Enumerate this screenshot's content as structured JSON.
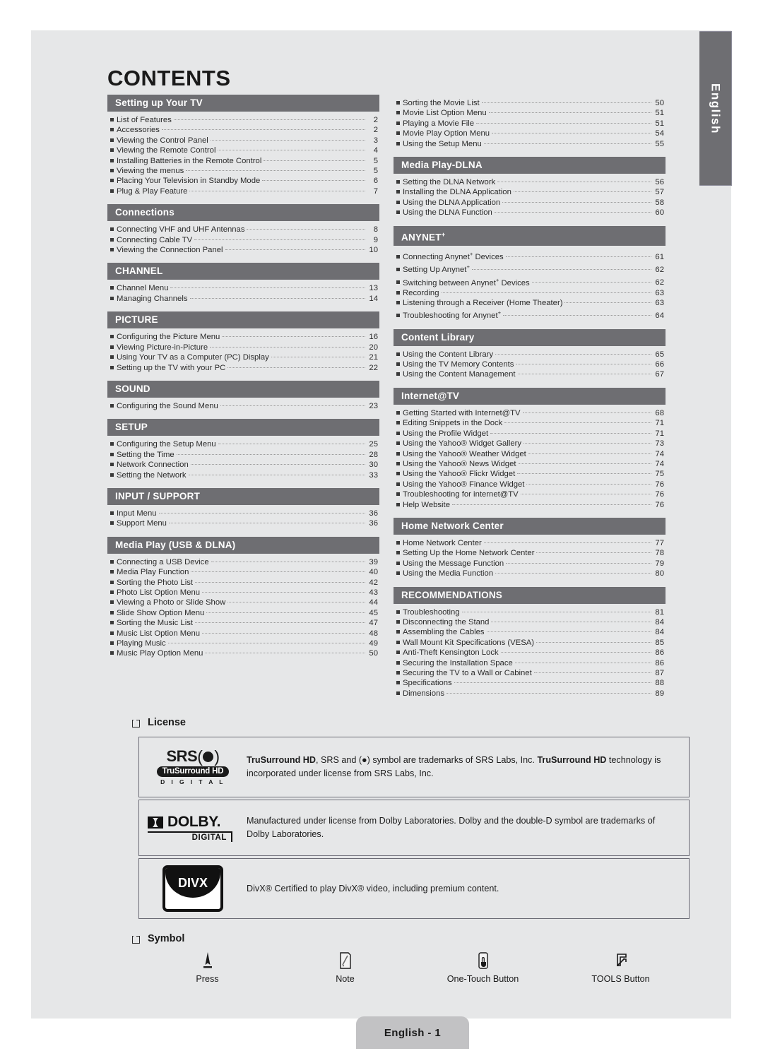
{
  "page": {
    "title": "CONTENTS",
    "side_tab_label": "English",
    "footer_label": "English - 1"
  },
  "left_column": [
    {
      "heading": "Setting up Your TV",
      "items": [
        {
          "label": "List of Features",
          "page": "2"
        },
        {
          "label": "Accessories",
          "page": "2"
        },
        {
          "label": "Viewing the Control Panel",
          "page": "3"
        },
        {
          "label": "Viewing the Remote Control",
          "page": "4"
        },
        {
          "label": "Installing Batteries in the Remote Control",
          "page": "5"
        },
        {
          "label": "Viewing the menus",
          "page": "5"
        },
        {
          "label": "Placing Your Television in Standby Mode",
          "page": "6"
        },
        {
          "label": "Plug & Play Feature",
          "page": "7"
        }
      ]
    },
    {
      "heading": "Connections",
      "items": [
        {
          "label": "Connecting VHF and UHF Antennas",
          "page": "8"
        },
        {
          "label": "Connecting Cable TV",
          "page": "9"
        },
        {
          "label": "Viewing the Connection Panel",
          "page": "10"
        }
      ]
    },
    {
      "heading": "CHANNEL",
      "items": [
        {
          "label": "Channel Menu",
          "page": "13"
        },
        {
          "label": "Managing Channels",
          "page": "14"
        }
      ]
    },
    {
      "heading": "PICTURE",
      "items": [
        {
          "label": "Configuring the Picture Menu",
          "page": "16"
        },
        {
          "label": "Viewing Picture-in-Picture",
          "page": "20"
        },
        {
          "label": "Using Your TV as a Computer (PC) Display",
          "page": "21"
        },
        {
          "label": "Setting up the TV with your PC",
          "page": "22"
        }
      ]
    },
    {
      "heading": "SOUND",
      "items": [
        {
          "label": "Configuring the Sound Menu",
          "page": "23"
        }
      ]
    },
    {
      "heading": "SETUP",
      "items": [
        {
          "label": "Configuring the Setup Menu",
          "page": "25"
        },
        {
          "label": "Setting the Time",
          "page": "28"
        },
        {
          "label": "Network Connection",
          "page": "30"
        },
        {
          "label": "Setting the Network",
          "page": "33"
        }
      ]
    },
    {
      "heading": "INPUT / SUPPORT",
      "items": [
        {
          "label": "Input Menu",
          "page": "36"
        },
        {
          "label": "Support Menu",
          "page": "36"
        }
      ]
    },
    {
      "heading": "Media Play (USB & DLNA)",
      "items": [
        {
          "label": "Connecting a USB Device",
          "page": "39"
        },
        {
          "label": "Media Play Function",
          "page": "40"
        },
        {
          "label": "Sorting the Photo List",
          "page": "42"
        },
        {
          "label": "Photo List Option Menu",
          "page": "43"
        },
        {
          "label": "Viewing a Photo or Slide Show",
          "page": "44"
        },
        {
          "label": "Slide Show Option Menu",
          "page": "45"
        },
        {
          "label": "Sorting the Music List",
          "page": "47"
        },
        {
          "label": "Music List Option Menu",
          "page": "48"
        },
        {
          "label": "Playing Music",
          "page": "49"
        },
        {
          "label": "Music Play Option Menu",
          "page": "50"
        }
      ]
    }
  ],
  "right_column": [
    {
      "heading": null,
      "items": [
        {
          "label": "Sorting the Movie List",
          "page": "50"
        },
        {
          "label": "Movie List Option Menu",
          "page": "51"
        },
        {
          "label": "Playing a Movie File",
          "page": "51"
        },
        {
          "label": "Movie Play Option Menu",
          "page": "54"
        },
        {
          "label": "Using the Setup Menu",
          "page": "55"
        }
      ]
    },
    {
      "heading": "Media Play-DLNA",
      "items": [
        {
          "label": "Setting the DLNA Network",
          "page": "56"
        },
        {
          "label": "Installing the DLNA Application",
          "page": "57"
        },
        {
          "label": "Using the DLNA Application",
          "page": "58"
        },
        {
          "label": "Using the DLNA Function",
          "page": "60"
        }
      ]
    },
    {
      "heading": "ANYNET+",
      "heading_html": "ANYNET<sup>+</sup>",
      "items": [
        {
          "label": "Connecting Anynet+ Devices",
          "label_html": "Connecting Anynet<sup>+</sup> Devices",
          "page": "61"
        },
        {
          "label": "Setting Up Anynet+",
          "label_html": "Setting Up Anynet<sup>+</sup>",
          "page": "62"
        },
        {
          "label": "Switching between Anynet+ Devices",
          "label_html": "Switching between Anynet<sup>+</sup> Devices",
          "page": "62"
        },
        {
          "label": "Recording",
          "page": "63"
        },
        {
          "label": "Listening through a Receiver (Home Theater)",
          "page": "63"
        },
        {
          "label": "Troubleshooting for Anynet+",
          "label_html": "Troubleshooting for Anynet<sup>+</sup>",
          "page": "64"
        }
      ]
    },
    {
      "heading": "Content Library",
      "items": [
        {
          "label": "Using the Content Library",
          "page": "65"
        },
        {
          "label": "Using the TV Memory Contents",
          "page": "66"
        },
        {
          "label": "Using the Content Management",
          "page": "67"
        }
      ]
    },
    {
      "heading": "Internet@TV",
      "items": [
        {
          "label": "Getting Started with Internet@TV",
          "page": "68"
        },
        {
          "label": "Editing Snippets in the Dock",
          "page": "71"
        },
        {
          "label": "Using the Profile Widget",
          "page": "71"
        },
        {
          "label": "Using the Yahoo® Widget Gallery",
          "page": "73"
        },
        {
          "label": "Using the Yahoo® Weather Widget",
          "page": "74"
        },
        {
          "label": "Using the Yahoo® News Widget",
          "page": "74"
        },
        {
          "label": "Using the Yahoo® Flickr Widget",
          "page": "75"
        },
        {
          "label": "Using the Yahoo® Finance Widget",
          "page": "76"
        },
        {
          "label": "Troubleshooting for internet@TV",
          "page": "76"
        },
        {
          "label": "Help Website",
          "page": "76"
        }
      ]
    },
    {
      "heading": "Home Network Center",
      "items": [
        {
          "label": "Home Network Center",
          "page": "77"
        },
        {
          "label": "Setting Up the Home Network Center",
          "page": "78"
        },
        {
          "label": "Using the Message Function",
          "page": "79"
        },
        {
          "label": "Using the Media Function",
          "page": "80"
        }
      ]
    },
    {
      "heading": "RECOMMENDATIONS",
      "items": [
        {
          "label": "Troubleshooting",
          "page": "81"
        },
        {
          "label": "Disconnecting the Stand",
          "page": "84"
        },
        {
          "label": "Assembling the Cables",
          "page": "84"
        },
        {
          "label": "Wall Mount Kit Specifications (VESA)",
          "page": "85"
        },
        {
          "label": "Anti-Theft Kensington Lock",
          "page": "86"
        },
        {
          "label": "Securing the Installation Space",
          "page": "86"
        },
        {
          "label": "Securing the TV to a Wall or Cabinet",
          "page": "87"
        },
        {
          "label": "Specifications",
          "page": "88"
        },
        {
          "label": "Dimensions",
          "page": "89"
        }
      ]
    }
  ],
  "license": {
    "heading": "License",
    "boxes": [
      {
        "logo": "srs-trusurround-hd-logo",
        "logo_text": {
          "top": "SRS",
          "mid": "TruSurround HD",
          "bottom": "D I G I T A L"
        },
        "text_lead": "TruSurround HD",
        "text_mid": ", SRS and (●) symbol are trademarks of SRS Labs, Inc. ",
        "text_bold2": "TruSurround HD",
        "text_tail": "technology is incorporated under license from SRS Labs, Inc."
      },
      {
        "logo": "dolby-digital-logo",
        "logo_text": {
          "top": "DOLBY.",
          "bottom": "DIGITAL"
        },
        "text": "Manufactured under license from Dolby Laboratories. Dolby and the double-D symbol are trademarks of Dolby Laboratories."
      },
      {
        "logo": "divx-logo",
        "logo_text": {
          "top": "DIVX"
        },
        "text": "DivX® Certified to play DivX® video, including premium content."
      }
    ]
  },
  "symbol": {
    "heading": "Symbol",
    "items": [
      {
        "icon": "press-pointer-icon",
        "label": "Press"
      },
      {
        "icon": "note-page-icon",
        "label": "Note"
      },
      {
        "icon": "one-touch-hand-icon",
        "label": "One-Touch Button"
      },
      {
        "icon": "tools-button-icon",
        "label": "TOOLS Button"
      }
    ]
  },
  "colors": {
    "page_bg": "#e6e7e8",
    "section_header_bg": "#6e6e72",
    "section_header_text": "#ffffff",
    "footer_bg": "#c2c2c4",
    "body_text": "#2b2b2b"
  }
}
